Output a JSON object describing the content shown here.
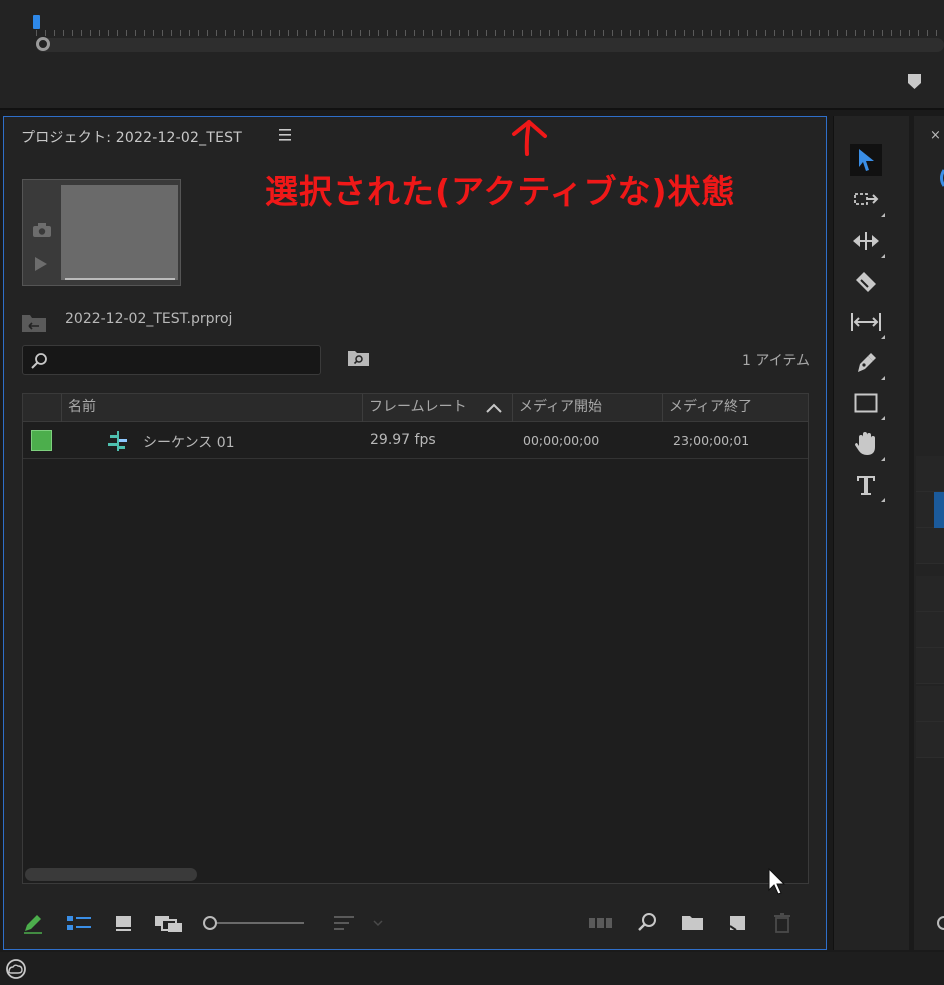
{
  "project_panel": {
    "title": "プロジェクト: 2022-12-02_TEST",
    "project_file": "2022-12-02_TEST.prproj",
    "search": {
      "value": "",
      "placeholder": ""
    },
    "item_count": "1 アイテム",
    "columns": [
      "名前",
      "フレームレート",
      "メディア開始",
      "メディア終了"
    ],
    "sort_column": "フレームレート",
    "rows": [
      {
        "name": "シーケンス 01",
        "frame_rate": "29.97 fps",
        "media_start": "00;00;00;00",
        "media_end": "23;00;00;01",
        "label_color": "#4cae4c"
      }
    ]
  },
  "annotation": {
    "text": "選択された(アクティブな)状態",
    "color": "#f01818"
  },
  "tools": [
    "selection-tool",
    "track-select-tool",
    "ripple-edit-tool",
    "razor-tool",
    "slip-tool",
    "pen-tool",
    "rectangle-tool",
    "hand-tool",
    "type-tool"
  ],
  "bottom_toolbar": [
    "write-on-icon",
    "list-view-icon",
    "icon-view-icon",
    "freeform-view-icon",
    "zoom-slider",
    "sort-icon",
    "automate-to-sequence-icon",
    "find-icon",
    "new-bin-icon",
    "new-item-icon",
    "clear-icon"
  ],
  "colors": {
    "accent": "#2e88e8",
    "panel_border_active": "#2f6fc9",
    "background": "#232323"
  }
}
